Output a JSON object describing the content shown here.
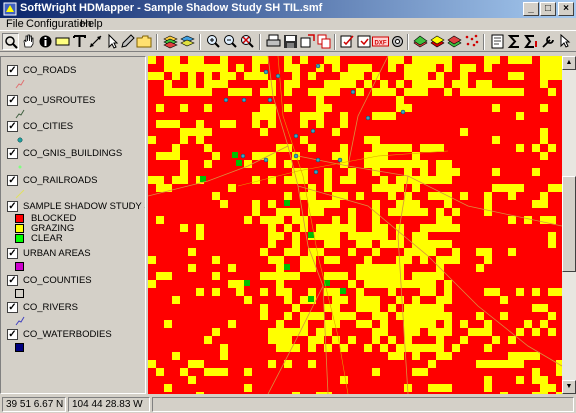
{
  "window": {
    "title": "SoftWright HDMapper - Sample Shadow Study SH TIL.smf",
    "minimize_label": "_",
    "maximize_label": "□",
    "close_label": "×"
  },
  "menu": {
    "items": [
      "File",
      "Configuration",
      "Help"
    ]
  },
  "toolbar": {
    "buttons": [
      "zoom-tool",
      "pan-tool",
      "info-tool",
      "label-tool",
      "text-tool",
      "measure-tool",
      "select-tool",
      "draw-tool",
      "open-folder",
      "layers",
      "layers-alt",
      "zoom-in",
      "zoom-out",
      "zoom-full",
      "print",
      "save",
      "export",
      "copy",
      "edit",
      "refresh",
      "import-dxf",
      "properties",
      "site-1",
      "site-2",
      "site-3",
      "site-4",
      "grid",
      "study",
      "sum",
      "sum-alt",
      "tools",
      "help"
    ],
    "dxf_label": "DXF"
  },
  "legend": {
    "layers": [
      {
        "name": "CO_ROADS",
        "checked": true,
        "symbol": "road-line-icon"
      },
      {
        "name": "CO_USROUTES",
        "checked": true,
        "symbol": "usroute-line-icon"
      },
      {
        "name": "CO_CITIES",
        "checked": true,
        "symbol": "city-dot-icon"
      },
      {
        "name": "CO_GNIS_BUILDINGS",
        "checked": true,
        "symbol": "building-dot-icon"
      },
      {
        "name": "CO_RAILROADS",
        "checked": true,
        "symbol": "railroad-line-icon"
      },
      {
        "name": "SAMPLE SHADOW STUDY SH TIL (I",
        "checked": true,
        "symbol": "study-icon"
      },
      {
        "name": "URBAN AREAS",
        "checked": true,
        "symbol": "urban-swatch"
      },
      {
        "name": "CO_COUNTIES",
        "checked": true,
        "symbol": "county-swatch"
      },
      {
        "name": "CO_RIVERS",
        "checked": true,
        "symbol": "river-line-icon"
      },
      {
        "name": "CO_WATERBODIES",
        "checked": true,
        "symbol": "water-swatch"
      }
    ],
    "shadow_classes": [
      {
        "label": "BLOCKED",
        "color": "#ff0000"
      },
      {
        "label": "GRAZING",
        "color": "#ffff00"
      },
      {
        "label": "CLEAR",
        "color": "#00ff00"
      }
    ],
    "colors": {
      "urban": "#cc00cc",
      "county": "#d4d0c8",
      "water": "#000080",
      "road": "#e07070",
      "usroute": "#406040",
      "city": "#20a0a0",
      "building": "#80ff80",
      "railroad": "#e0e060",
      "river": "#4040c0"
    },
    "check_mark": "✓"
  },
  "map": {
    "blocked_color": "#ff0000",
    "grazing_color": "#ffff00",
    "clear_color": "#00c000",
    "city_color": "#40a0c0"
  },
  "status": {
    "latitude": "39 51 6.67 N",
    "longitude": "104 44 28.83 W"
  }
}
